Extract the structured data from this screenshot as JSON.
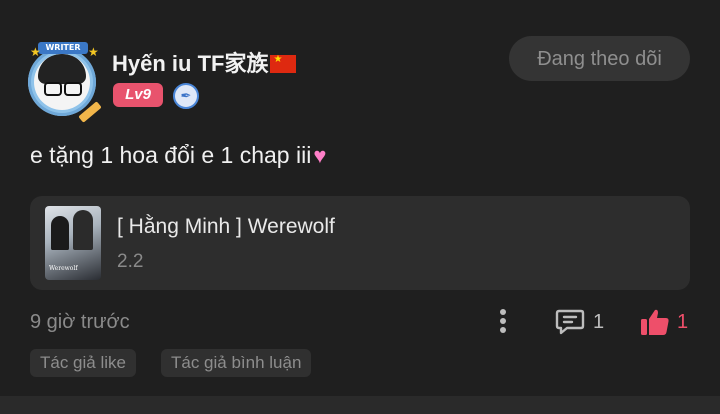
{
  "user": {
    "name": "Hyến iu TF家族",
    "level": "Lv9",
    "avatar_banner": "WRITER"
  },
  "follow_button": {
    "label": "Đang theo dõi"
  },
  "comment": {
    "text": "e tặng 1 hoa đổi e 1 chap iii"
  },
  "linked_story": {
    "title": "[ Hằng Minh ] Werewolf",
    "subtitle": "2.2",
    "cover_text": "Werewolf"
  },
  "footer": {
    "time": "9 giờ trước",
    "comment_count": "1",
    "like_count": "1"
  },
  "tags": {
    "author_like": "Tác giả like",
    "author_comment": "Tác giả bình luận"
  },
  "colors": {
    "background": "#1f1f1f",
    "level_badge": "#e8536d",
    "like_accent": "#ee4f6a",
    "heart": "#ff7fc8"
  },
  "icons": {
    "flag": "china-flag-icon",
    "verify": "pen-badge-icon",
    "heart": "pink-heart-icon",
    "more": "more-vertical-icon",
    "comment": "comment-icon",
    "like": "thumbs-up-icon"
  }
}
